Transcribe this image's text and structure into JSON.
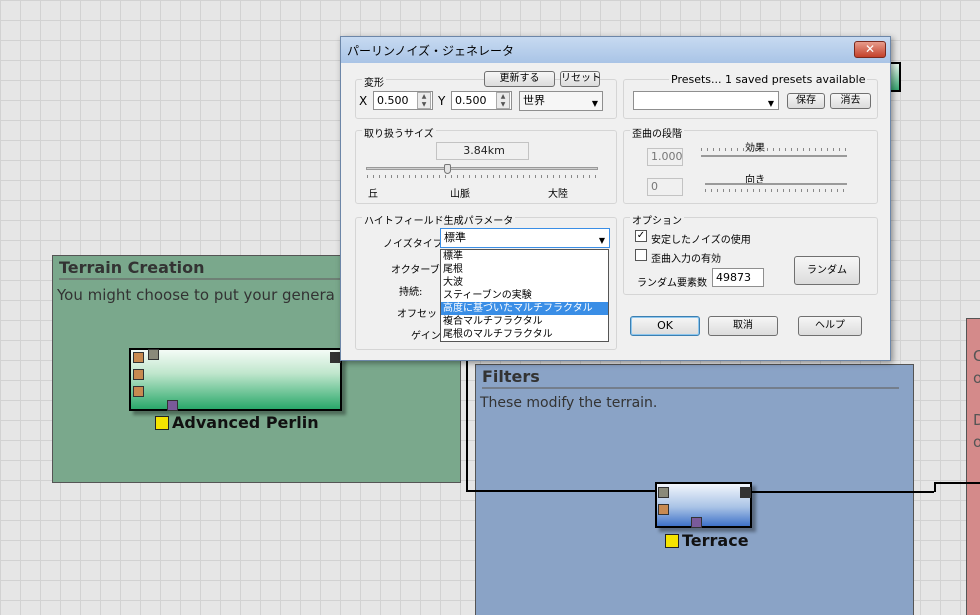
{
  "canvas": {
    "terrain_group": {
      "title": "Terrain Creation",
      "description": "You might choose to put your genera"
    },
    "filters_group": {
      "title": "Filters",
      "description": "These modify the terrain."
    },
    "right_group": {
      "lines": [
        "C",
        "o",
        "D",
        "o"
      ]
    },
    "nodes": [
      {
        "label": "Advanced Perlin"
      },
      {
        "label": "Terrace"
      }
    ]
  },
  "dialog": {
    "title": "パーリンノイズ・ジェネレータ",
    "close_label": "✕",
    "transform": {
      "legend": "変形",
      "update_label": "更新する",
      "reset_label": "リセット",
      "x_label": "X",
      "x_value": "0.500",
      "y_label": "Y",
      "y_value": "0.500",
      "space_value": "世界"
    },
    "presets": {
      "label": "Presets... 1 saved presets available",
      "value": "",
      "save_label": "保存",
      "delete_label": "消去"
    },
    "size": {
      "legend": "取り扱うサイズ",
      "value": "3.84km",
      "slider_fraction": 0.35,
      "labels": [
        "丘",
        "山脈",
        "大陸"
      ]
    },
    "warp": {
      "legend": "歪曲の段階",
      "effect_label": "効果",
      "effect_value": "1.000",
      "direction_label": "向き",
      "direction_value": "0"
    },
    "heightfield": {
      "legend": "ハイトフィールド生成パラメータ",
      "noise_type_label": "ノイズタイプ:",
      "noise_type_value": "標準",
      "octaves_label": "オクターブ:",
      "persistence_label": "持続:",
      "offset_label": "オフセット:",
      "gain_label": "ゲイン:",
      "noise_options": [
        "標準",
        "尾根",
        "大波",
        "スティーブンの実験",
        "高度に基づいたマルチフラクタル",
        "複合マルチフラクタル",
        "尾根のマルチフラクタル"
      ],
      "selected_option_index": 4
    },
    "options": {
      "legend": "オプション",
      "stable_noise_label": "安定したノイズの使用",
      "stable_noise_checked": true,
      "warp_input_label": "歪曲入力の有効",
      "warp_input_checked": false,
      "random_seed_label": "ランダム要素数",
      "random_seed_value": "49873",
      "random_button_label": "ランダム"
    },
    "footer": {
      "ok_label": "OK",
      "cancel_label": "取消",
      "help_label": "ヘルプ"
    }
  }
}
